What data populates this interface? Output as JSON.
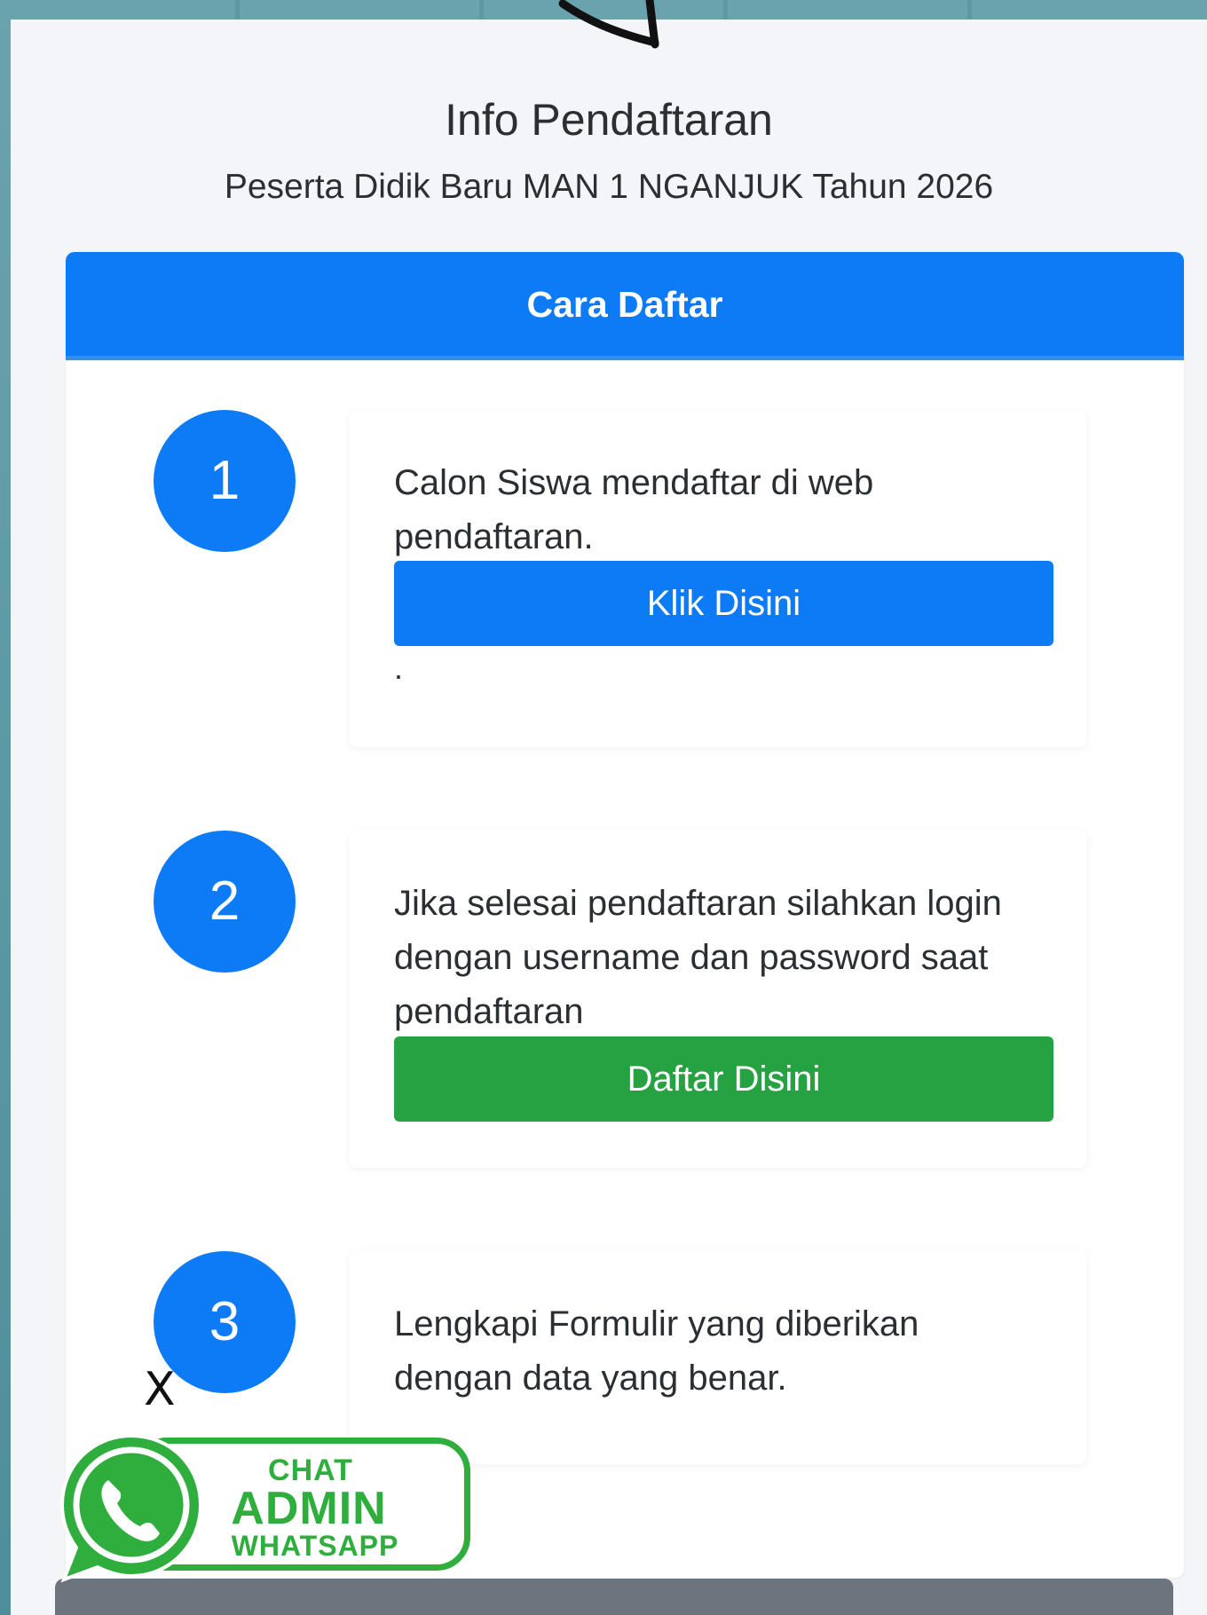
{
  "header": {
    "title": "Info Pendaftaran",
    "subtitle": "Peserta Didik Baru MAN 1 NGANJUK Tahun 2026"
  },
  "card": {
    "header_label": "Cara Daftar"
  },
  "steps": [
    {
      "number": "1",
      "text": "Calon Siswa mendaftar di web pendaftaran.",
      "button_label": "Klik Disini",
      "extra": "."
    },
    {
      "number": "2",
      "text": "Jika selesai pendaftaran silahkan login dengan username dan password saat pendaftaran",
      "button_label": "Daftar Disini"
    },
    {
      "number": "3",
      "text": "Lengkapi Formulir yang diberikan dengan data yang benar."
    }
  ],
  "whatsapp_widget": {
    "close_label": "X",
    "line1": "CHAT",
    "line2": "ADMIN",
    "line3": "WHATSAPP",
    "icon": "whatsapp-icon"
  },
  "colors": {
    "primary": "#0d7bf6",
    "success": "#27a243",
    "whatsapp": "#2fae3e",
    "background": "#f3f5f8"
  }
}
